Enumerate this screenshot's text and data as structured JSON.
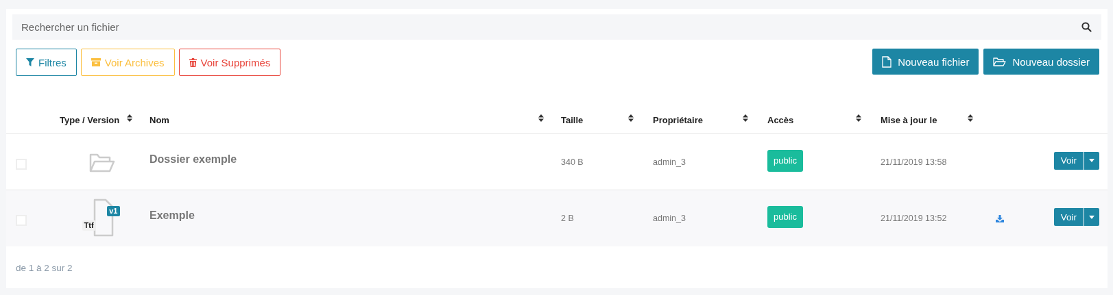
{
  "search": {
    "placeholder": "Rechercher un fichier"
  },
  "toolbar_left": [
    {
      "kind": "filter",
      "label": "Filtres"
    },
    {
      "kind": "archive",
      "label": "Voir Archives"
    },
    {
      "kind": "trash",
      "label": "Voir Supprimés"
    }
  ],
  "toolbar_right": [
    {
      "kind": "file",
      "label": "Nouveau fichier"
    },
    {
      "kind": "folder",
      "label": "Nouveau dossier"
    }
  ],
  "table": {
    "columns": [
      {
        "label": "Type / Version"
      },
      {
        "label": "Nom"
      },
      {
        "label": "Taille"
      },
      {
        "label": "Propriétaire"
      },
      {
        "label": "Accès"
      },
      {
        "label": "Mise à jour le"
      }
    ],
    "rows": [
      {
        "kind": "folder",
        "checked": false,
        "highlighted": false,
        "name": "Dossier exemple",
        "size": "340 B",
        "owner": "admin_3",
        "access": "public",
        "updated": "21/11/2019 13:58",
        "downloadable": false,
        "action": "Voir"
      },
      {
        "kind": "file",
        "checked": false,
        "highlighted": true,
        "version": "v1",
        "extension": "Ttf",
        "name": "Exemple",
        "size": "2 B",
        "owner": "admin_3",
        "access": "public",
        "updated": "21/11/2019 13:52",
        "downloadable": true,
        "action": "Voir"
      }
    ]
  },
  "pagination": "de 1 à 2 sur 2"
}
